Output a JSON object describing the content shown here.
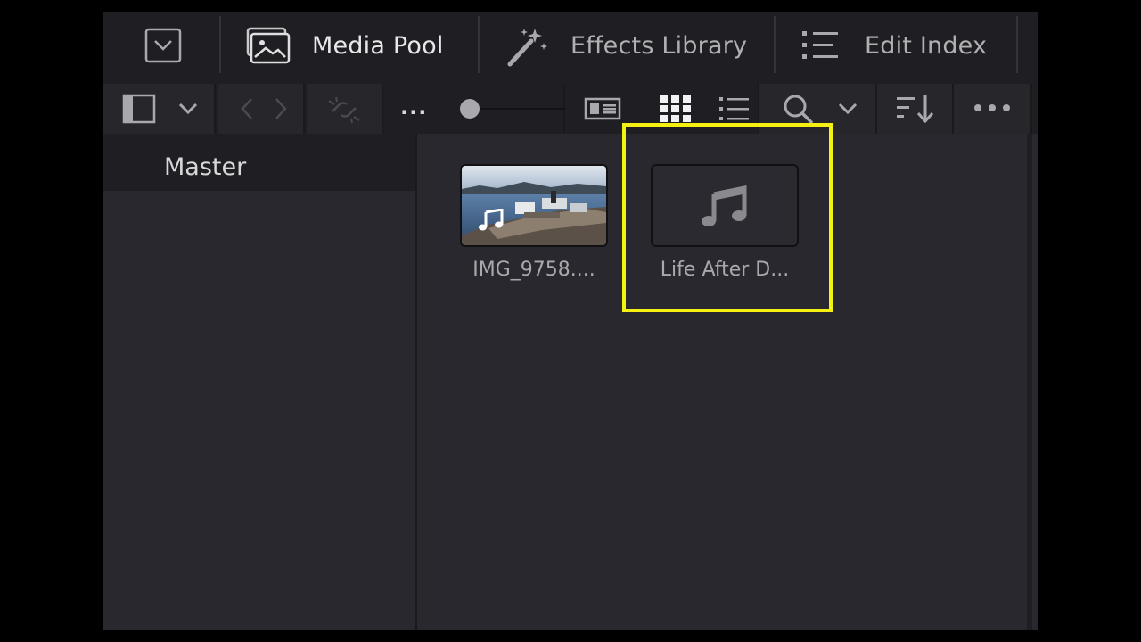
{
  "tabs": {
    "toggle_icon": "chevron-down-box-icon",
    "media_pool": {
      "label": "Media Pool",
      "icon": "image-stack-icon"
    },
    "effects_library": {
      "label": "Effects Library",
      "icon": "magic-wand-icon"
    },
    "edit_index": {
      "label": "Edit Index",
      "icon": "list-icon"
    }
  },
  "toolbar": {
    "more_label": "...",
    "icons": [
      "panel-toggle-icon",
      "chevron-down-icon",
      "back-icon",
      "forward-icon",
      "unlink-icon",
      "zoom-slider",
      "metadata-view-icon",
      "thumbnail-view-icon",
      "list-view-icon",
      "search-icon",
      "chevron-down-icon",
      "sort-icon",
      "more-options-icon"
    ]
  },
  "sidebar": {
    "items": [
      {
        "label": "Master",
        "selected": true
      }
    ]
  },
  "clips": [
    {
      "name": "IMG_9758....",
      "type": "video-with-audio",
      "icon": "music-note-icon"
    },
    {
      "name": "Life After D...",
      "type": "audio",
      "icon": "music-note-icon",
      "highlighted": true
    }
  ],
  "colors": {
    "highlight": "#f5ef12",
    "panel": "#28282e",
    "header": "#1f1f23"
  }
}
